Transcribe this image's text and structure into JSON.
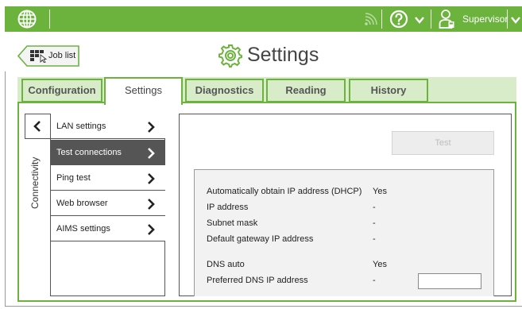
{
  "topbar": {
    "user_label": "Supervisor",
    "icons": [
      "globe-icon",
      "wifi-icon",
      "help-icon",
      "chevron-down-icon",
      "user-icon",
      "chevron-down-icon"
    ],
    "color": "#6cb33e"
  },
  "header": {
    "back_label": "Job list",
    "title": "Settings"
  },
  "tabs": [
    {
      "label": "Configuration",
      "active": false
    },
    {
      "label": "Settings",
      "active": true
    },
    {
      "label": "Diagnostics",
      "active": false
    },
    {
      "label": "Reading",
      "active": false
    },
    {
      "label": "History",
      "active": false
    }
  ],
  "sidebar": {
    "section_label": "Connectivity",
    "items": [
      {
        "label": "LAN settings",
        "active": false
      },
      {
        "label": "Test connections",
        "active": true
      },
      {
        "label": "Ping test",
        "active": false
      },
      {
        "label": "Web browser",
        "active": false
      },
      {
        "label": "AIMS settings",
        "active": false
      }
    ]
  },
  "panel": {
    "test_button_label": "Test",
    "rows": [
      {
        "label": "Automatically obtain IP address (DHCP)",
        "value": "Yes"
      },
      {
        "label": "IP address",
        "value": "-"
      },
      {
        "label": "Subnet mask",
        "value": "-"
      },
      {
        "label": "Default gateway IP address",
        "value": "-"
      },
      {
        "label": "DNS auto",
        "value": "Yes"
      },
      {
        "label": "Preferred DNS IP address",
        "value": "-"
      }
    ],
    "dns_input_value": ""
  }
}
